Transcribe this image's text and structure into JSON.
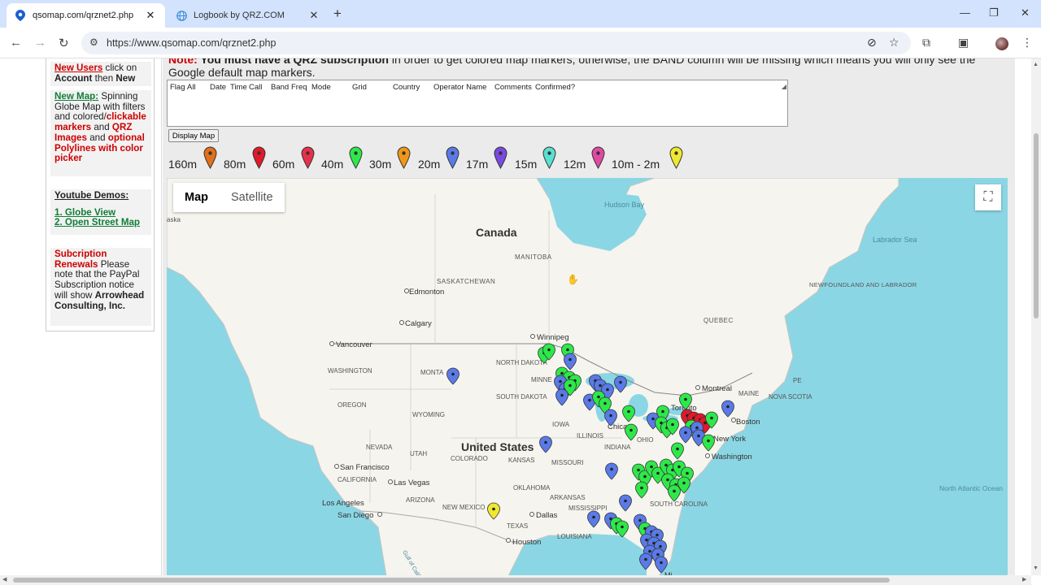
{
  "browser": {
    "tabs": [
      {
        "title": "qsomap.com/qrznet2.php",
        "active": true
      },
      {
        "title": "Logbook by QRZ.COM",
        "active": false
      }
    ],
    "url": "https://www.qsomap.com/qrznet2.php"
  },
  "sidebar": {
    "new_users": {
      "link": "New Users",
      "t1": " click on ",
      "b1": "Account",
      "t2": " then ",
      "b2": "New"
    },
    "new_map": {
      "link": "New Map:",
      "t1": " Spinning Globe Map with filters and colored/",
      "r1": "clickable markers",
      "t2": " and ",
      "r2": "QRZ Images",
      "t3": " and ",
      "r3": "optional Polylines with color picker"
    },
    "youtube": {
      "heading": "Youtube Demos:",
      "link1": "1. Globe View",
      "link2": "2. Open Street Map"
    },
    "subscription": {
      "title": "Subcription Renewals",
      "t1": " Please note that the PayPal Subscription notice will show ",
      "b1": "Arrowhead Consulting, Inc."
    }
  },
  "notice": {
    "label": "Note:",
    "bold": " You must have a QRZ subscription",
    "rest": " in order to get colored map markers, otherwise, the BAND column will be missing which means you will only see the Google default map markers."
  },
  "log_columns": [
    "Flag",
    "All",
    "Date",
    "Time",
    "Call",
    "Band",
    "Freq",
    "Mode",
    "Grid",
    "Country",
    "Operator Name",
    "Comments",
    "Confirmed?"
  ],
  "display_button": "Display Map",
  "legend": [
    {
      "band": "160m",
      "color": "#e0701a"
    },
    {
      "band": "80m",
      "color": "#e01a2a"
    },
    {
      "band": "60m",
      "color": "#e8304a"
    },
    {
      "band": "40m",
      "color": "#2ee84a"
    },
    {
      "band": "30m",
      "color": "#f0961a"
    },
    {
      "band": "20m",
      "color": "#5a7ae8"
    },
    {
      "band": "17m",
      "color": "#7a4ae0"
    },
    {
      "band": "15m",
      "color": "#5ae0d0"
    },
    {
      "band": "12m",
      "color": "#e04aa0"
    },
    {
      "band": "10m - 2m",
      "color": "#f0e830"
    }
  ],
  "map": {
    "type_controls": [
      "Map",
      "Satellite"
    ],
    "labels": {
      "canada": "Canada",
      "usa": "United States",
      "hudson_bay": "Hudson Bay",
      "labrador_sea": "Labrador Sea",
      "manitoba": "MANITOBA",
      "saskatchewan": "SASKATCHEWAN",
      "newfoundland": "NEWFOUNDLAND AND LABRADOR",
      "quebec": "QUEBEC",
      "alaska_frag": "aska",
      "edmonton": "Edmonton",
      "calgary": "Calgary",
      "winnipeg": "Winnipeg",
      "vancouver": "Vancouver",
      "washington_state": "WASHINGTON",
      "montana": "MONTA",
      "north_dakota": "NORTH DAKOTA",
      "minn": "MINNE",
      "south_dakota": "SOUTH DAKOTA",
      "oregon": "OREGON",
      "wyoming": "WYOMING",
      "iowa": "IOWA",
      "nevada": "NEVADA",
      "utah": "UTAH",
      "colorado": "COLORADO",
      "kansas": "KANSAS",
      "missouri": "MISSOURI",
      "illinois": "ILLINOIS",
      "indiana": "INDIANA",
      "ohio": "OHIO",
      "chicago": "Chicago",
      "toronto": "Toronto",
      "montreal": "Montreal",
      "maine": "MAINE",
      "pe": "PE",
      "nova_scotia": "NOVA SCOTIA",
      "boston": "Boston",
      "new_york": "New York",
      "washington_dc": "Washington",
      "san_francisco": "San Francisco",
      "california": "CALIFORNIA",
      "las_vegas": "Las Vegas",
      "arizona": "ARIZONA",
      "los_angeles": "Los Angeles",
      "san_diego": "San Diego",
      "new_mexico": "NEW MEXICO",
      "oklahoma": "OKLAHOMA",
      "arkansas": "ARKANSAS",
      "mississippi": "MISSISSIPPI",
      "south_carolina": "SOUTH CAROLINA",
      "dallas": "Dallas",
      "texas": "TEXAS",
      "louisiana": "LOUISIANA",
      "houston": "Houston",
      "north_atlantic": "North Atlantic Ocean",
      "gulf": "Gulf of California",
      "miami_frag": "Mi"
    }
  }
}
